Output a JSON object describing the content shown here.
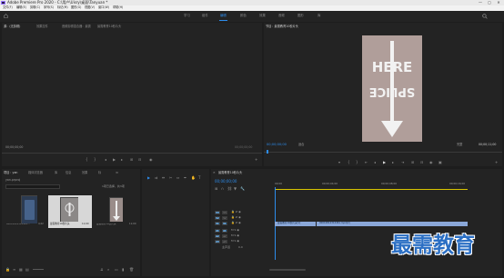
{
  "window": {
    "title": "Adobe Premiere Pro 2020 - C:\\用户\\Uisry\\桌面\\Tanyuan *",
    "controls": [
      "—",
      "▢",
      "✕"
    ]
  },
  "menu": [
    "文件(F)",
    "编辑(E)",
    "剪辑(C)",
    "序列(S)",
    "标记(M)",
    "图形(G)",
    "视图(V)",
    "窗口(W)",
    "帮助(H)"
  ],
  "workspaces": {
    "items": [
      "学习",
      "组件",
      "编辑",
      "颜色",
      "效果",
      "音频",
      "图形",
      "库"
    ],
    "active_index": 2
  },
  "source_panel": {
    "tabs": [
      "源：(无剪辑)",
      "效果控件",
      "音频剪辑混合器：最需",
      "最需教育10秒片头"
    ],
    "timecode_left": "00;00;00;00",
    "timecode_right": "00;00;00;00"
  },
  "program_panel": {
    "tab": "节目：最需教育10秒片头",
    "timecode": "00;00;00;00",
    "fit_label": "适合",
    "full_label": "完整",
    "duration": "00;00;11;00",
    "image_text_top": "HERE",
    "image_text_bottom": "SPLICE",
    "image_bg": "#b09e9a"
  },
  "project_panel": {
    "tabs": [
      "项目：yan",
      "媒体浏览器",
      "库",
      "信息",
      "效果",
      "标"
    ],
    "search_placeholder": "",
    "project_name": "yan.prproj",
    "selection_info": "1项已选择，共3项",
    "items": [
      {
        "name": "00010814312461...",
        "duration": "4;22"
      },
      {
        "name": "最需教育10秒片头",
        "duration": "11;00"
      },
      {
        "name": "最需教育10秒片头",
        "duration": "11;00"
      }
    ]
  },
  "timeline_panel": {
    "tab": "最需教育10秒片头",
    "timecode": "00;00;00;00",
    "ruler": [
      "00;00",
      "00;00;04;00",
      "00;00;08;00",
      "00;00;16;00"
    ],
    "video_tracks": [
      "V3",
      "V2",
      "V1"
    ],
    "audio_tracks": [
      "A1",
      "A2",
      "A3"
    ],
    "master_label": "主声道",
    "master_value": "0.0",
    "clip_v1_a": "最需教育10秒片头[V]",
    "clip_v1_b": "00010814312461.mp4[V]",
    "clip_color": "#8aa7d8"
  },
  "watermark": "最需教育"
}
